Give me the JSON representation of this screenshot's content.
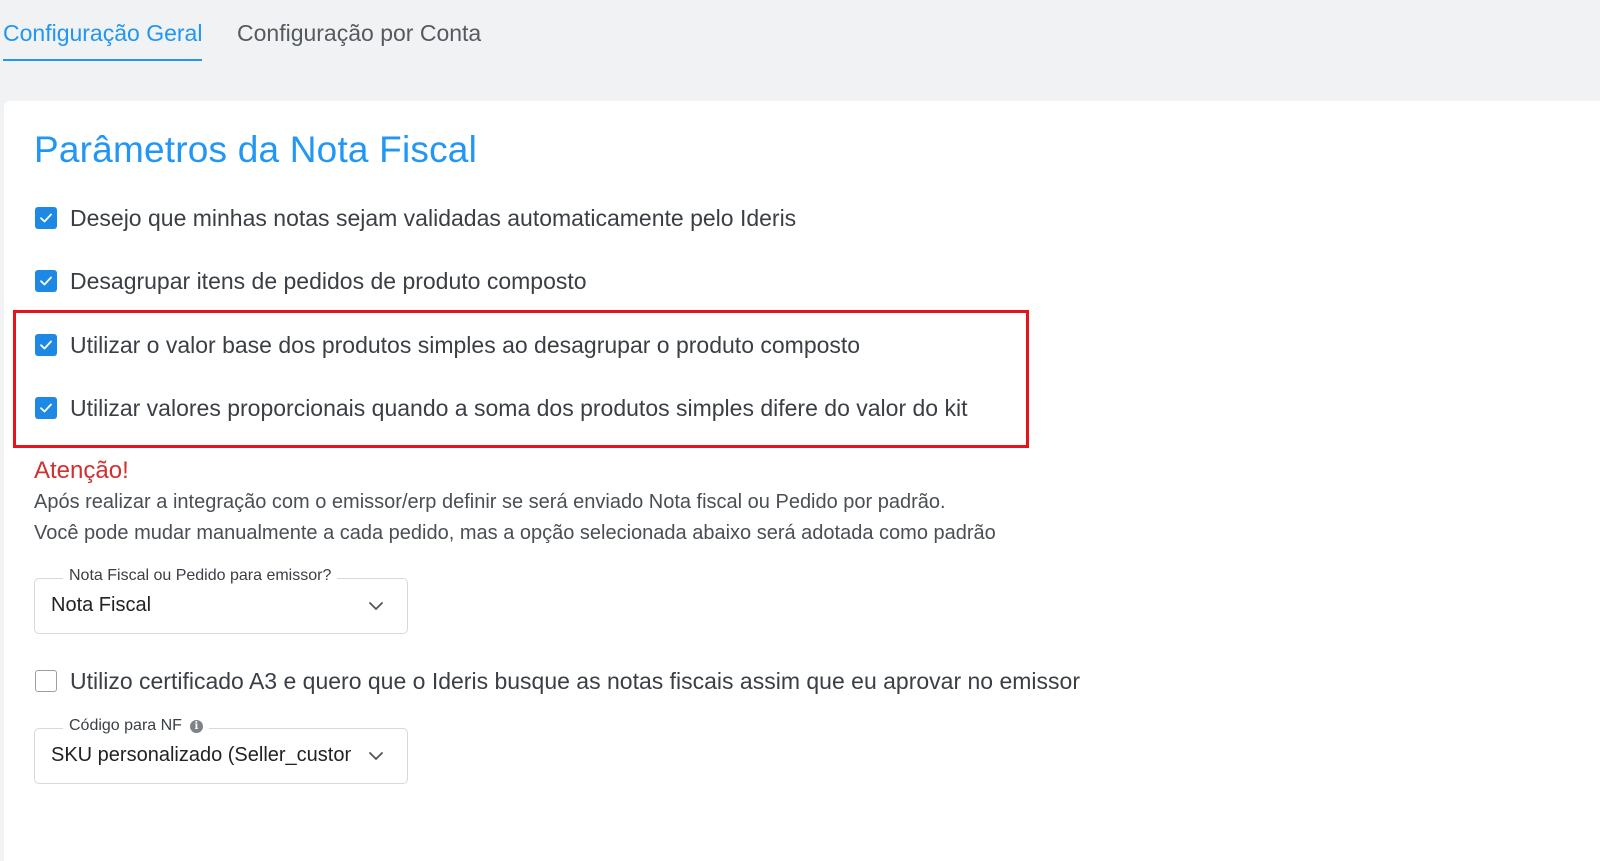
{
  "tabs": [
    {
      "label": "Configuração Geral",
      "active": true
    },
    {
      "label": "Configuração por Conta",
      "active": false
    }
  ],
  "section": {
    "title": "Parâmetros da Nota Fiscal"
  },
  "checkboxes": [
    {
      "label": "Desejo que minhas notas sejam validadas automaticamente pelo Ideris",
      "checked": true
    },
    {
      "label": "Desagrupar itens de pedidos de produto composto",
      "checked": true
    },
    {
      "label": "Utilizar o valor base dos produtos simples ao desagrupar o produto composto",
      "checked": true
    },
    {
      "label": "Utilizar valores proporcionais quando a soma dos produtos simples difere do valor do kit",
      "checked": true
    }
  ],
  "attention": {
    "title": "Atenção!",
    "line1": "Após realizar a integração com o emissor/erp definir se será enviado Nota fiscal ou Pedido por padrão.",
    "line2": "Você pode mudar manualmente a cada pedido, mas a opção selecionada abaixo será adotada como padrão"
  },
  "emitter_select": {
    "label": "Nota Fiscal ou Pedido para emissor?",
    "value": "Nota Fiscal"
  },
  "a3_checkbox": {
    "label": "Utilizo certificado A3 e quero que o Ideris busque as notas fiscais assim que eu aprovar no emissor",
    "checked": false
  },
  "nf_code_select": {
    "label": "Código para NF",
    "value": "SKU personalizado (Seller_custom_field)"
  },
  "colors": {
    "accent": "#2196f3",
    "checkbox": "#1e88e5",
    "highlight": "#e8131a",
    "warning": "#d32f2f"
  }
}
